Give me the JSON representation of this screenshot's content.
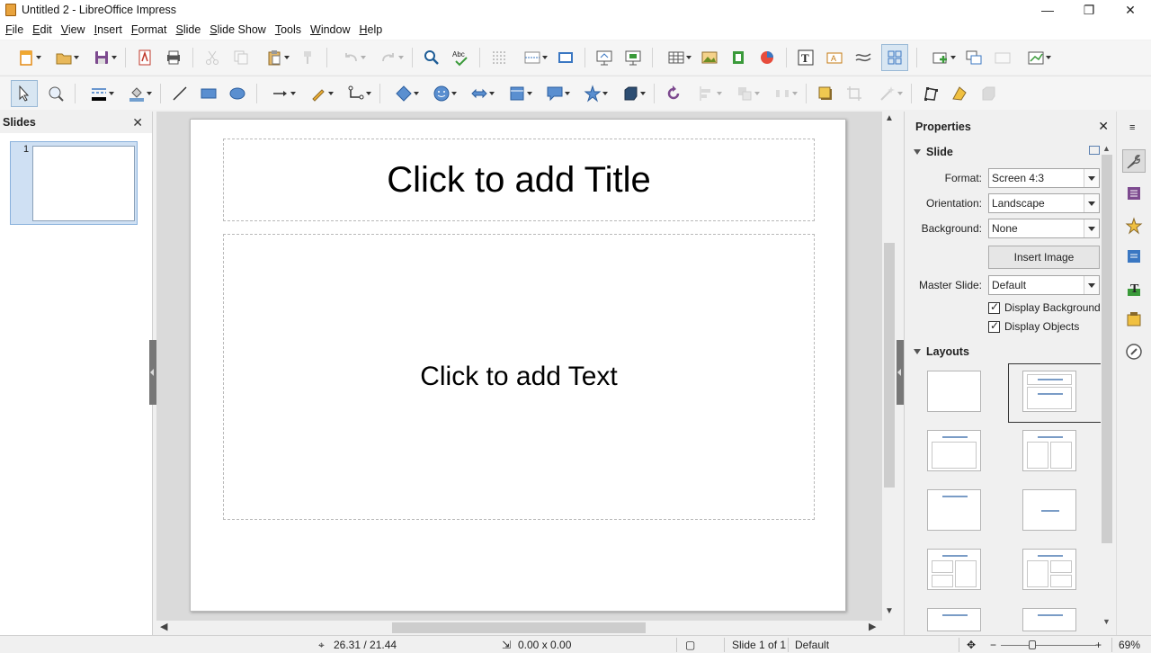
{
  "window": {
    "title": "Untitled 2 - LibreOffice Impress",
    "minimize_glyph": "—",
    "maximize_glyph": "❐",
    "close_glyph": "✕"
  },
  "menubar": {
    "items": [
      "File",
      "Edit",
      "View",
      "Insert",
      "Format",
      "Slide",
      "Slide Show",
      "Tools",
      "Window",
      "Help"
    ]
  },
  "slides_pane": {
    "title": "Slides",
    "close_glyph": "✕",
    "slides": [
      {
        "number": "1"
      }
    ]
  },
  "slide": {
    "title_placeholder": "Click to add Title",
    "body_placeholder": "Click to add Text"
  },
  "properties": {
    "title": "Properties",
    "close_glyph": "✕",
    "slide_section": {
      "title": "Slide",
      "format_label": "Format:",
      "format_value": "Screen 4:3",
      "orientation_label": "Orientation:",
      "orientation_value": "Landscape",
      "background_label": "Background:",
      "background_value": "None",
      "insert_image_label": "Insert Image",
      "master_slide_label": "Master Slide:",
      "master_slide_value": "Default",
      "display_background_label": "Display Background",
      "display_background_checked": true,
      "display_objects_label": "Display Objects",
      "display_objects_checked": true
    },
    "layouts_section": {
      "title": "Layouts"
    }
  },
  "statusbar": {
    "position": "26.31 / 21.44",
    "size": "0.00 x 0.00",
    "slide_info": "Slide 1 of 1",
    "master": "Default",
    "zoom": "69%"
  },
  "colors": {
    "accent": "#7a9cc6",
    "selection": "#cfe0f3"
  }
}
